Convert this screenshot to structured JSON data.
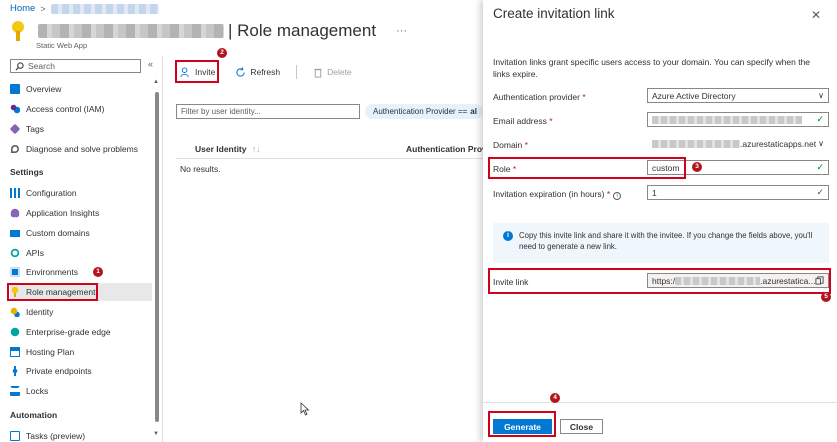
{
  "breadcrumb": {
    "home": "Home",
    "separator": ">"
  },
  "header": {
    "title": "| Role management",
    "subtitle": "Static Web App",
    "more": "···"
  },
  "sidebar": {
    "search_placeholder": "Search",
    "collapse": "«",
    "items": [
      {
        "label": "Overview",
        "icon": "overview-icon",
        "color": "#0078d4"
      },
      {
        "label": "Access control (IAM)",
        "icon": "people-icon",
        "color": "#5c2d91"
      },
      {
        "label": "Tags",
        "icon": "tag-icon",
        "color": "#8764b8"
      },
      {
        "label": "Diagnose and solve problems",
        "icon": "wrench-icon",
        "color": "#605e5c"
      }
    ],
    "settings_heading": "Settings",
    "settings_items": [
      {
        "label": "Configuration",
        "icon": "sliders-icon",
        "color": "#0078d4"
      },
      {
        "label": "Application Insights",
        "icon": "bulb-icon",
        "color": "#8764b8"
      },
      {
        "label": "Custom domains",
        "icon": "domain-icon",
        "color": "#0078d4"
      },
      {
        "label": "APIs",
        "icon": "api-icon",
        "color": "#00a4a6"
      },
      {
        "label": "Environments",
        "icon": "environments-icon",
        "color": "#0078d4"
      },
      {
        "label": "Role management",
        "icon": "key-icon",
        "color": "#f2c811"
      },
      {
        "label": "Identity",
        "icon": "identity-icon",
        "color": "#e8b400"
      },
      {
        "label": "Enterprise-grade edge",
        "icon": "globe-icon",
        "color": "#00a4a6"
      },
      {
        "label": "Hosting Plan",
        "icon": "plan-icon",
        "color": "#0078d4"
      },
      {
        "label": "Private endpoints",
        "icon": "endpoint-icon",
        "color": "#0078d4"
      },
      {
        "label": "Locks",
        "icon": "lock-icon",
        "color": "#0078d4"
      }
    ],
    "automation_heading": "Automation",
    "automation_items": [
      {
        "label": "Tasks (preview)",
        "icon": "tasks-icon",
        "color": "#0078d4"
      }
    ]
  },
  "toolbar": {
    "invite": "Invite",
    "refresh": "Refresh",
    "delete": "Delete"
  },
  "filter": {
    "placeholder": "Filter by user identity...",
    "pill_label": "Authentication Provider ==",
    "pill_value": "al"
  },
  "table": {
    "columns": [
      "User Identity",
      "Authentication Provi"
    ],
    "empty": "No results."
  },
  "panel": {
    "title": "Create invitation link",
    "close": "✕",
    "description": "Invitation links grant specific users access to your domain. You can specify when the links expire.",
    "fields": {
      "auth_provider": {
        "label": "Authentication provider",
        "value": "Azure Active Directory"
      },
      "email": {
        "label": "Email address"
      },
      "domain": {
        "label": "Domain",
        "suffix": ".azurestaticapps.net"
      },
      "role": {
        "label": "Role",
        "value": "custom"
      },
      "expiration": {
        "label": "Invitation expiration (in hours)",
        "value": "1"
      }
    },
    "info": "Copy this invite link and share it with the invitee. If you change the fields above, you'll need to generate a new link.",
    "invite_link": {
      "label": "Invite link",
      "prefix": "https:/",
      "suffix": ".azurestatica..."
    },
    "generate": "Generate",
    "close_button": "Close"
  },
  "annotations": [
    "1",
    "2",
    "3",
    "4",
    "5"
  ],
  "colors": {
    "accent": "#0078d4",
    "highlight": "#d0021b",
    "valid": "#107c10"
  }
}
